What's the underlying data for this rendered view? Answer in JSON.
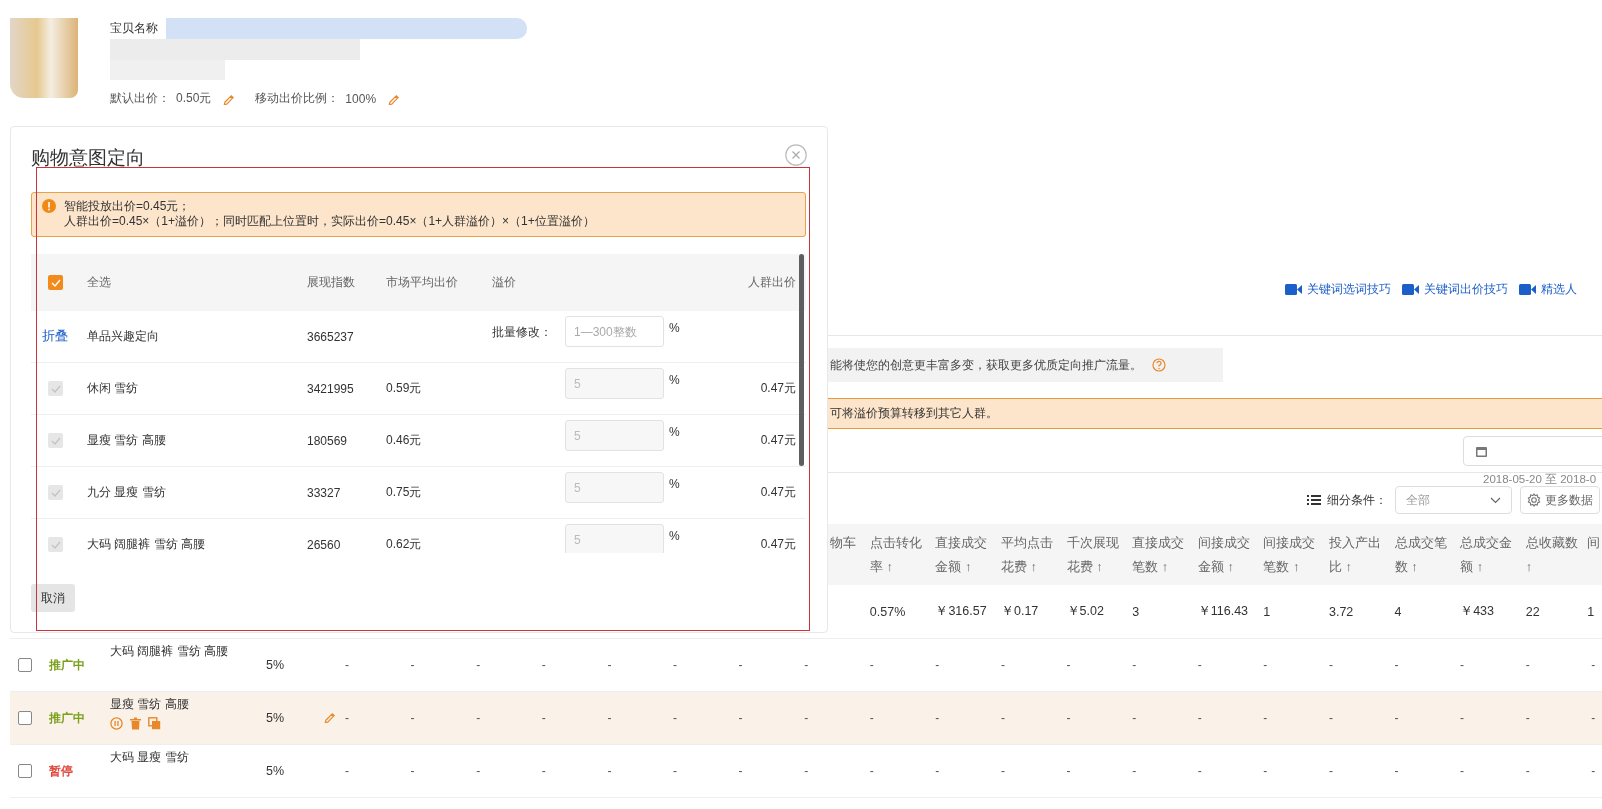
{
  "product": {
    "name_label": "宝贝名称",
    "default_bid_label": "默认出价：",
    "default_bid": "0.50元",
    "mobile_ratio_label": "移动出价比例：",
    "mobile_ratio": "100%"
  },
  "tutorial_links": [
    {
      "label": "关键词选词技巧"
    },
    {
      "label": "关键词出价技巧"
    },
    {
      "label": "精选人"
    }
  ],
  "creative_notice": "能将使您的创意更丰富多变，获取更多优质定向推广流量。",
  "premium_notice": "可将溢价预算转移到其它人群。",
  "date_range": "2018-05-20 至 2018-0",
  "segment_filter": {
    "label": "细分条件：",
    "value": "全部"
  },
  "more_data_button": "更多数据",
  "table": {
    "columns": [
      "物车",
      "点击转化率 ↑",
      "直接成交金额 ↑",
      "平均点击花费 ↑",
      "千次展现花费 ↑",
      "直接成交笔数 ↑",
      "间接成交金额 ↑",
      "间接成交笔数 ↑",
      "投入产出比 ↑",
      "总成交笔数 ↑",
      "总成交金额 ↑",
      "总收藏数 ↑",
      "间"
    ],
    "summary_row": [
      "0.57%",
      "￥316.57",
      "￥0.17",
      "￥5.02",
      "3",
      "￥116.43",
      "1",
      "3.72",
      "4",
      "￥433",
      "22",
      "1"
    ],
    "rows": [
      {
        "checked": false,
        "status": "推广中",
        "color": "#7aa01c",
        "name": "大码 阔腿裤 雪纺 高腰",
        "premium": "5%",
        "hovered": false,
        "metrics": [
          "-",
          "-",
          "-",
          "-",
          "-",
          "-",
          "-",
          "-",
          "-",
          "-",
          "-",
          "-",
          "-",
          "-",
          "-",
          "-",
          "-",
          "-",
          "-",
          "-"
        ]
      },
      {
        "checked": false,
        "status": "推广中",
        "color": "#7aa01c",
        "name": "显瘦 雪纺 高腰",
        "premium": "5%",
        "hovered": true,
        "metrics": [
          "-",
          "-",
          "-",
          "-",
          "-",
          "-",
          "-",
          "-",
          "-",
          "-",
          "-",
          "-",
          "-",
          "-",
          "-",
          "-",
          "-",
          "-",
          "-",
          "-"
        ]
      },
      {
        "checked": false,
        "status": "暂停",
        "color": "#e0463a",
        "name": "大码 显瘦 雪纺",
        "premium": "5%",
        "hovered": false,
        "metrics": [
          "-",
          "-",
          "-",
          "-",
          "-",
          "-",
          "-",
          "-",
          "-",
          "-",
          "-",
          "-",
          "-",
          "-",
          "-",
          "-",
          "-",
          "-",
          "-",
          "-"
        ]
      }
    ]
  },
  "dialog": {
    "title": "购物意图定向",
    "alert_lines": [
      "智能投放出价=0.45元；",
      "人群出价=0.45×（1+溢价）；同时匹配上位置时，实际出价=0.45×（1+人群溢价）×（1+位置溢价）"
    ],
    "columns": {
      "select_all": "全选",
      "impressions": "展现指数",
      "market_avg": "市场平均出价",
      "premium": "溢价",
      "crowd_bid": "人群出价"
    },
    "select_all_checked": true,
    "group": {
      "toggle": "折叠",
      "name": "单品兴趣定向",
      "impressions": "3665237",
      "batch_label": "批量修改：",
      "batch_placeholder": "1—300整数",
      "unit": "%"
    },
    "rows": [
      {
        "checked": true,
        "disabled": true,
        "name": "休闲 雪纺",
        "impressions": "3421995",
        "market_avg": "0.59元",
        "premium": "5",
        "unit": "%",
        "crowd_bid": "0.47元"
      },
      {
        "checked": true,
        "disabled": true,
        "name": "显瘦 雪纺 高腰",
        "impressions": "180569",
        "market_avg": "0.46元",
        "premium": "5",
        "unit": "%",
        "crowd_bid": "0.47元"
      },
      {
        "checked": true,
        "disabled": true,
        "name": "九分 显瘦 雪纺",
        "impressions": "33327",
        "market_avg": "0.75元",
        "premium": "5",
        "unit": "%",
        "crowd_bid": "0.47元"
      },
      {
        "checked": true,
        "disabled": true,
        "name": "大码 阔腿裤 雪纺 高腰",
        "impressions": "26560",
        "market_avg": "0.62元",
        "premium": "5",
        "unit": "%",
        "crowd_bid": "0.47元"
      }
    ],
    "cancel_button": "取消"
  }
}
